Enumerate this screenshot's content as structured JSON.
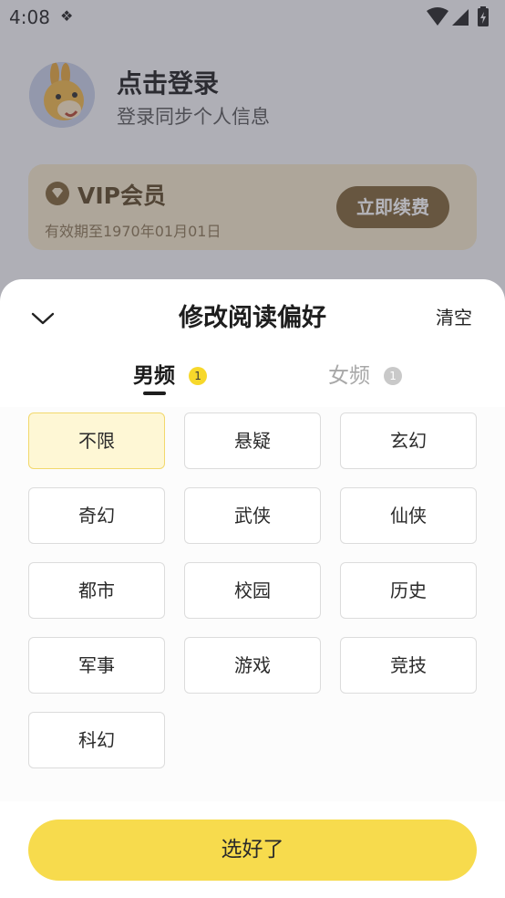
{
  "status_bar": {
    "time": "4:08",
    "notification_glyph": "❖"
  },
  "profile": {
    "login_title": "点击登录",
    "login_subtitle": "登录同步个人信息"
  },
  "vip": {
    "title": "VIP会员",
    "expiry": "有效期至1970年01月01日",
    "renew_label": "立即续费"
  },
  "sheet": {
    "title": "修改阅读偏好",
    "clear_label": "清空",
    "tabs": [
      {
        "label": "男频",
        "badge": "1"
      },
      {
        "label": "女频",
        "badge": "1"
      }
    ],
    "genres": [
      "不限",
      "悬疑",
      "玄幻",
      "奇幻",
      "武侠",
      "仙侠",
      "都市",
      "校园",
      "历史",
      "军事",
      "游戏",
      "竞技",
      "科幻"
    ],
    "selected_genre": "不限",
    "confirm_label": "选好了"
  },
  "colors": {
    "accent": "#f7db4d",
    "selected_chip_bg": "#fef7d5",
    "vip_button": "#7d6133"
  }
}
